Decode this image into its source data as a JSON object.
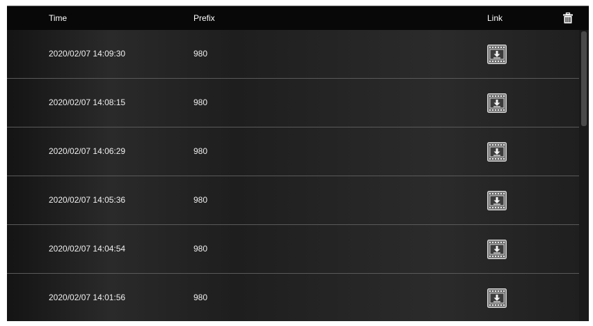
{
  "header": {
    "time_label": "Time",
    "prefix_label": "Prefix",
    "link_label": "Link",
    "delete_all_icon": "trash-icon"
  },
  "rows": [
    {
      "time": "2020/02/07 14:09:30",
      "prefix": "980",
      "link_icon": "video-download-icon"
    },
    {
      "time": "2020/02/07 14:08:15",
      "prefix": "980",
      "link_icon": "video-download-icon"
    },
    {
      "time": "2020/02/07 14:06:29",
      "prefix": "980",
      "link_icon": "video-download-icon"
    },
    {
      "time": "2020/02/07 14:05:36",
      "prefix": "980",
      "link_icon": "video-download-icon"
    },
    {
      "time": "2020/02/07 14:04:54",
      "prefix": "980",
      "link_icon": "video-download-icon"
    },
    {
      "time": "2020/02/07 14:01:56",
      "prefix": "980",
      "link_icon": "video-download-icon"
    }
  ],
  "colors": {
    "header_bg": "#080808",
    "row_bg": "#1c1c1c",
    "text": "#f0f0f0",
    "divider": "#5a5a5a"
  }
}
